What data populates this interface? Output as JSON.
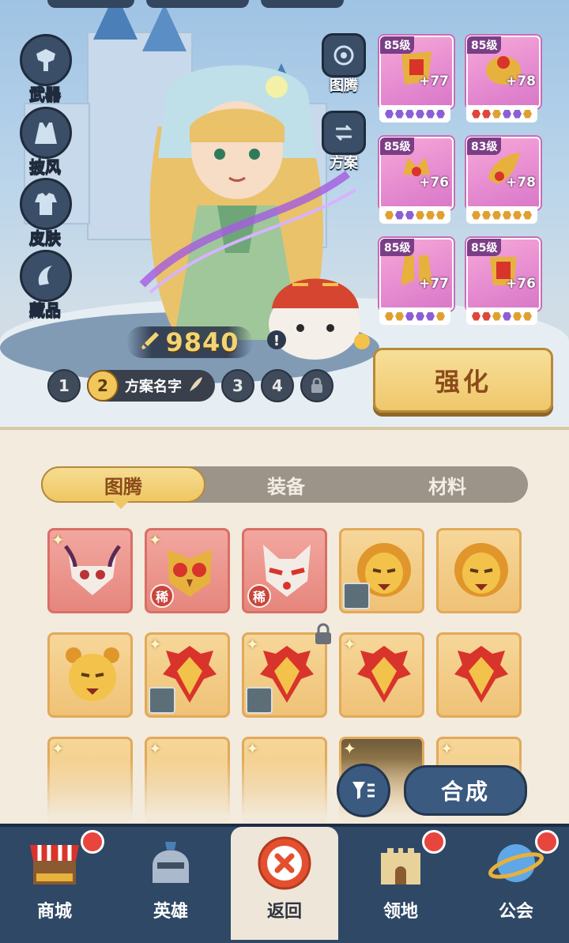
{
  "side_menu": [
    {
      "label": "武器",
      "icon": "weapon-icon"
    },
    {
      "label": "披风",
      "icon": "cape-icon"
    },
    {
      "label": "皮肤",
      "icon": "skin-icon"
    },
    {
      "label": "藏品",
      "icon": "collection-icon"
    }
  ],
  "quick_buttons": [
    {
      "label": "图腾",
      "icon": "totem-icon"
    },
    {
      "label": "方案",
      "icon": "plan-icon"
    }
  ],
  "power": "9840",
  "plans": {
    "numbers": [
      "1",
      "2",
      "3",
      "4"
    ],
    "active_name": "方案名字"
  },
  "enhance_label": "强化",
  "equipment": [
    {
      "level": "85级",
      "plus": "+77",
      "gems": [
        "#8b5fd6",
        "#8b5fd6",
        "#8b5fd6",
        "#8b5fd6",
        "#8b5fd6",
        "#8b5fd6"
      ]
    },
    {
      "level": "85级",
      "plus": "+78",
      "gems": [
        "#e0453a",
        "#e0453a",
        "#e0a030",
        "#8b5fd6",
        "#8b5fd6",
        "#e0a030"
      ]
    },
    {
      "level": "85级",
      "plus": "+76",
      "gems": [
        "#e0a030",
        "#8b5fd6",
        "#8b5fd6",
        "#e0a030",
        "#e0a030",
        "#e0a030"
      ]
    },
    {
      "level": "83级",
      "plus": "+78",
      "gems": [
        "#e0a030",
        "#e0a030",
        "#e0a030",
        "#e0a030",
        "#e0a030",
        "#e0a030"
      ]
    },
    {
      "level": "85级",
      "plus": "+77",
      "gems": [
        "#e0a030",
        "#e0a030",
        "#8b5fd6",
        "#8b5fd6",
        "#8b5fd6",
        "#e0a030"
      ]
    },
    {
      "level": "85级",
      "plus": "+76",
      "gems": [
        "#e0453a",
        "#e0453a",
        "#e0a030",
        "#8b5fd6",
        "#e0a030",
        "#e0a030"
      ]
    }
  ],
  "tabs": [
    "图腾",
    "装备",
    "材料"
  ],
  "active_tab": 0,
  "rare_badge": "稀",
  "compose_label": "合成",
  "nav": [
    {
      "label": "商城",
      "icon": "shop-icon",
      "dot": true
    },
    {
      "label": "英雄",
      "icon": "hero-helmet-icon",
      "dot": false
    },
    {
      "label": "返回",
      "icon": "close-icon",
      "dot": false
    },
    {
      "label": "领地",
      "icon": "castle-icon",
      "dot": true
    },
    {
      "label": "公会",
      "icon": "planet-icon",
      "dot": true
    }
  ],
  "colors": {
    "accent_gold": "#efc663",
    "nav_bg": "#2f4866",
    "badge_red": "#e8453c"
  }
}
